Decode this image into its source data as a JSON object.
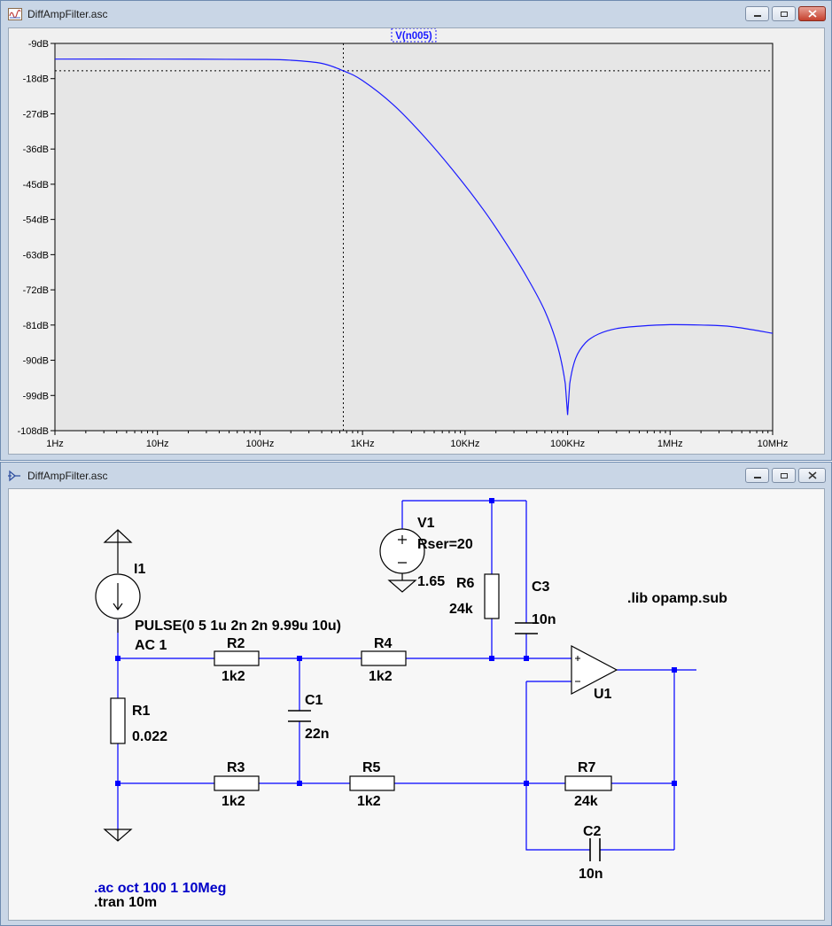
{
  "plot_window": {
    "title": "DiffAmpFilter.asc",
    "trace_label": "V(n005)",
    "colors": {
      "trace": "#1a1aff",
      "plot_bg": "#e6e6e6",
      "axis": "#000000"
    }
  },
  "schematic_window": {
    "title": "DiffAmpFilter.asc",
    "colors": {
      "wire": "#0000ff",
      "component": "#000000",
      "directive": "#0000c8"
    },
    "components": {
      "I1": {
        "name": "I1",
        "value": "PULSE(0 5 1u 2n 2n 9.99u 10u)",
        "value2": "AC 1"
      },
      "V1": {
        "name": "V1",
        "param": "Rser=20",
        "value": "1.65"
      },
      "R1": {
        "name": "R1",
        "value": "0.022"
      },
      "R2": {
        "name": "R2",
        "value": "1k2"
      },
      "R3": {
        "name": "R3",
        "value": "1k2"
      },
      "R4": {
        "name": "R4",
        "value": "1k2"
      },
      "R5": {
        "name": "R5",
        "value": "1k2"
      },
      "R6": {
        "name": "R6",
        "value": "24k"
      },
      "R7": {
        "name": "R7",
        "value": "24k"
      },
      "C1": {
        "name": "C1",
        "value": "22n"
      },
      "C2": {
        "name": "C2",
        "value": "10n"
      },
      "C3": {
        "name": "C3",
        "value": "10n"
      },
      "U1": {
        "name": "U1"
      }
    },
    "directives": {
      "lib": ".lib opamp.sub",
      "ac": ".ac oct 100 1 10Meg",
      "tran": ".tran 10m"
    }
  },
  "chart_data": {
    "type": "line",
    "title": "V(n005)",
    "x_scale": "log",
    "xlim": [
      1,
      10000000
    ],
    "x_ticks": [
      "1Hz",
      "10Hz",
      "100Hz",
      "1KHz",
      "10KHz",
      "100KHz",
      "1MHz",
      "10MHz"
    ],
    "ylim": [
      -108,
      -9
    ],
    "y_ticks": [
      "-9dB",
      "-18dB",
      "-27dB",
      "-36dB",
      "-45dB",
      "-54dB",
      "-63dB",
      "-72dB",
      "-81dB",
      "-90dB",
      "-99dB",
      "-108dB"
    ],
    "grid": false,
    "cursor": {
      "x": 650,
      "y": -16
    },
    "series": [
      {
        "color": "#1a1aff",
        "x": [
          1,
          10,
          100,
          200,
          400,
          650,
          1000,
          2000,
          4000,
          8000,
          15000,
          25000,
          40000,
          60000,
          80000,
          95000,
          100000,
          105000,
          120000,
          150000,
          200000,
          300000,
          500000,
          1000000,
          2000000,
          4000000,
          10000000
        ],
        "y": [
          -13,
          -13,
          -13.1,
          -13.3,
          -14.1,
          -16,
          -18.5,
          -24.7,
          -32.8,
          -42.1,
          -51.4,
          -60,
          -68.7,
          -77.4,
          -86.5,
          -96,
          -104,
          -96,
          -89.5,
          -85.5,
          -83.3,
          -81.9,
          -81.3,
          -80.9,
          -81,
          -81.4,
          -83.1
        ]
      }
    ]
  }
}
